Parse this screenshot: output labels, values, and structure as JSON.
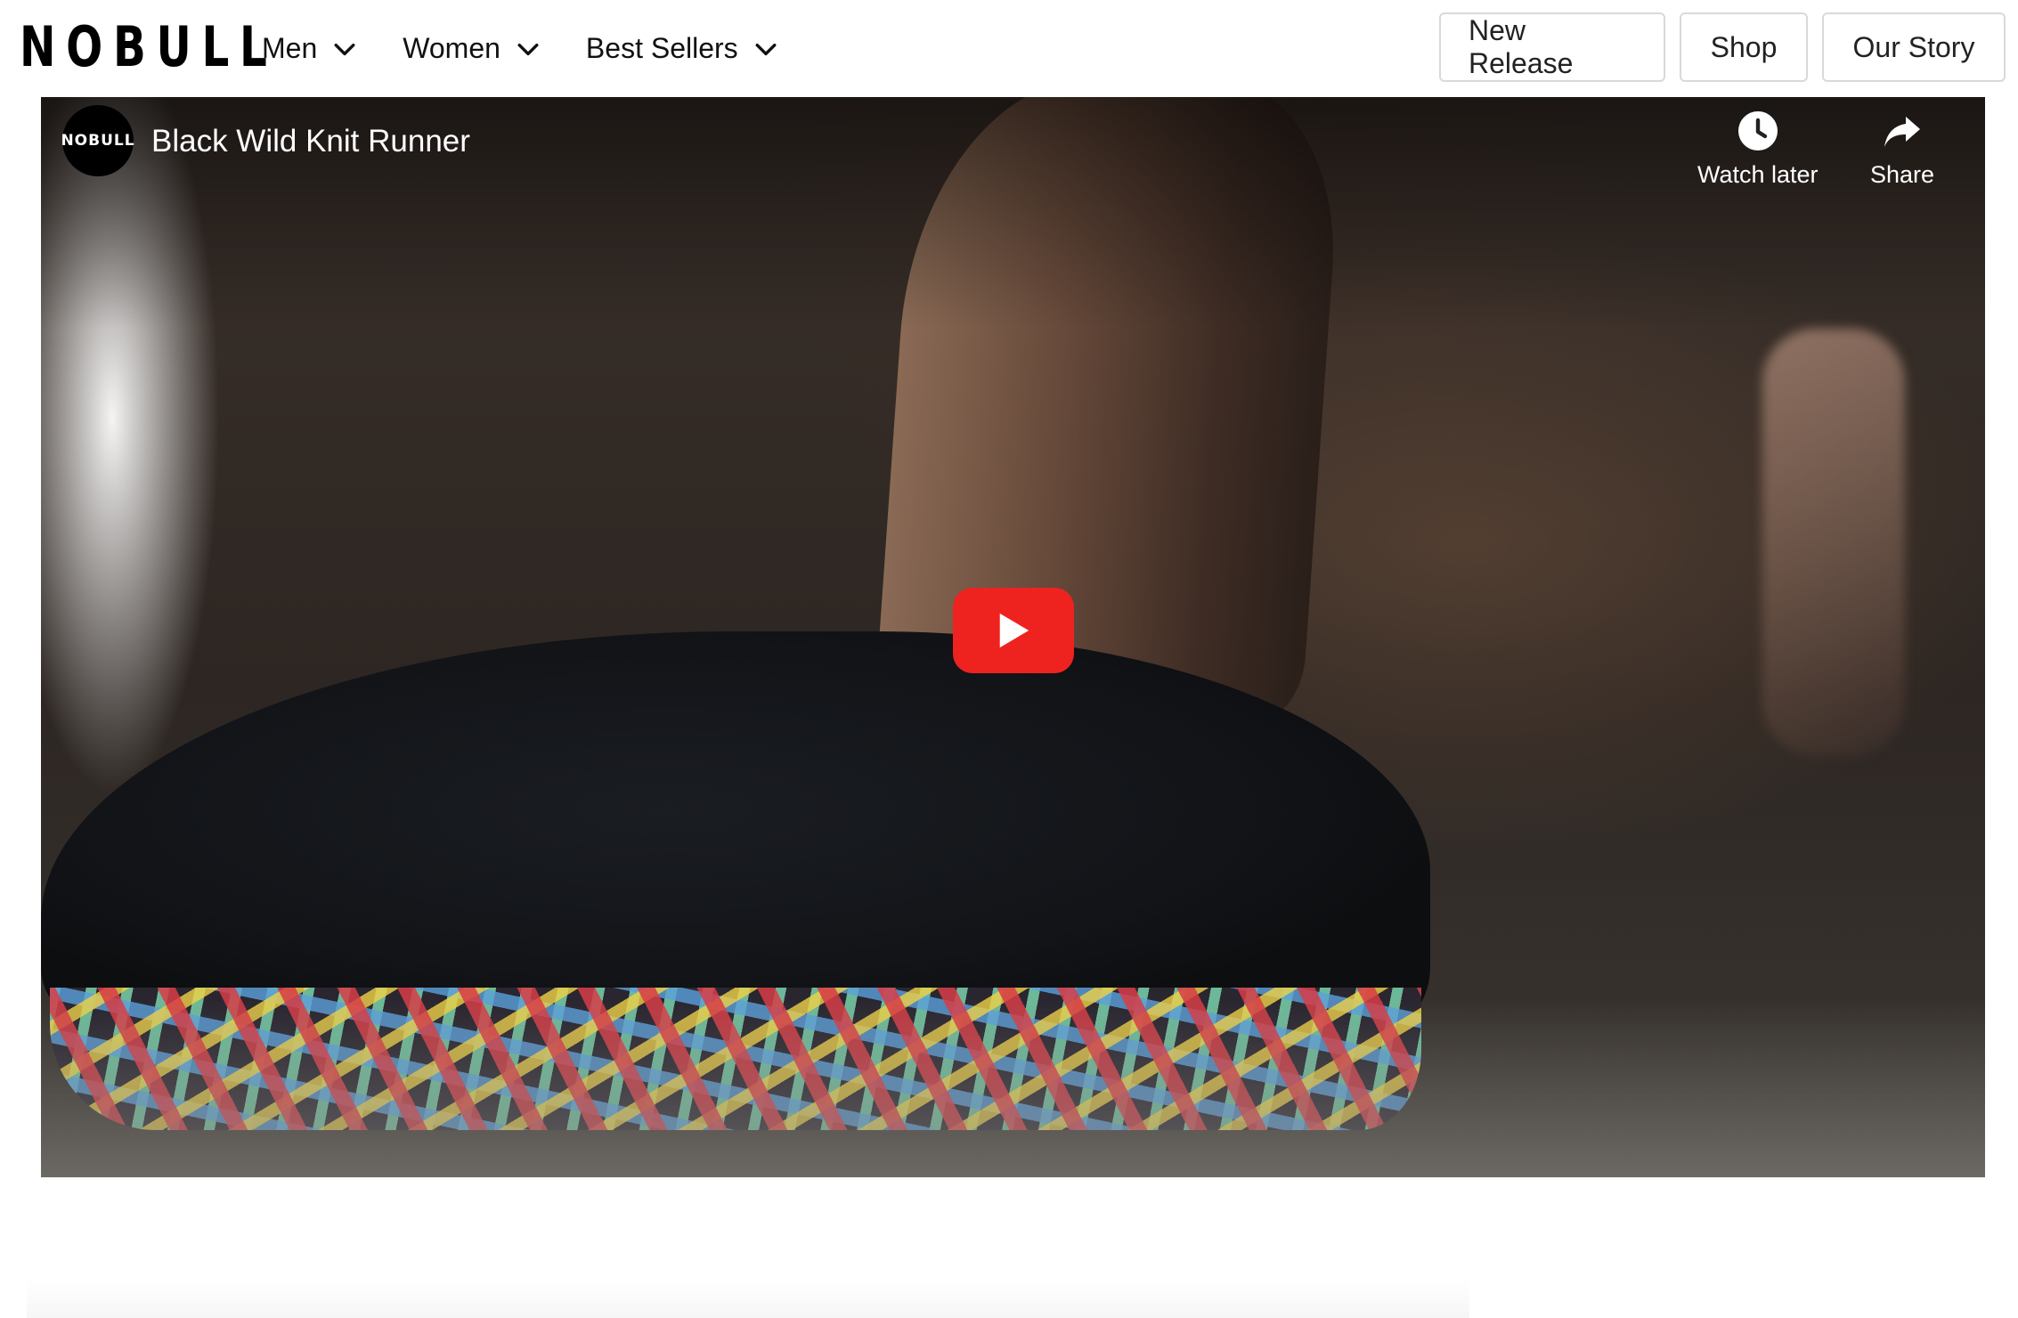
{
  "header": {
    "logo_text": "NOBULL",
    "nav": [
      {
        "label": "Men"
      },
      {
        "label": "Women"
      },
      {
        "label": "Best Sellers"
      }
    ],
    "buttons": {
      "new_release": "New Release",
      "shop": "Shop",
      "our_story": "Our Story"
    }
  },
  "video": {
    "channel_avatar_text": "NOBULL",
    "title": "Black Wild Knit Runner",
    "watch_later_label": "Watch later",
    "share_label": "Share",
    "play_button_color": "#ee2320"
  },
  "colors": {
    "text_primary": "#111111",
    "button_border": "#d9d9d9",
    "youtube_red": "#ee2320"
  }
}
